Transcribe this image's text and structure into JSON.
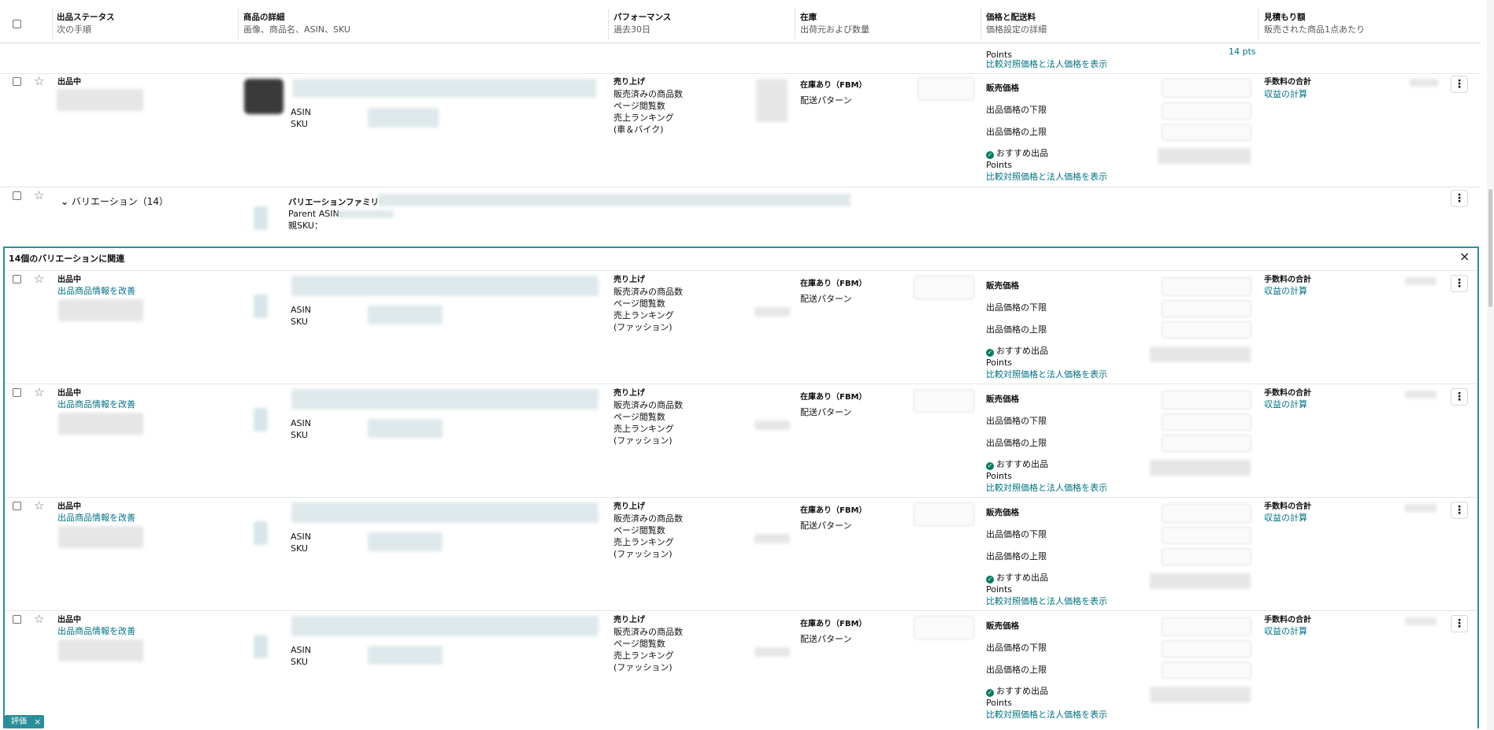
{
  "header": {
    "col_status": {
      "title": "出品ステータス",
      "sub": "次の手順"
    },
    "col_product": {
      "title": "商品の詳細",
      "sub": "画像、商品名、ASIN、SKU"
    },
    "col_perf": {
      "title": "パフォーマンス",
      "sub": "過去30日"
    },
    "col_stock": {
      "title": "在庫",
      "sub": "出荷元および数量"
    },
    "col_price": {
      "title": "価格と配送料",
      "sub": "価格設定の詳細"
    },
    "col_est": {
      "title": "見積もり額",
      "sub": "販売された商品1点あたり"
    }
  },
  "top_partial": {
    "points": "Points",
    "compare_link": "比較対照価格と法人価格を表示",
    "pts_value": "14 pts"
  },
  "row1": {
    "status": "出品中",
    "asin_label": "ASIN",
    "sku_label": "SKU",
    "perf": [
      "売り上げ",
      "販売済みの商品数",
      "ページ閲覧数",
      "売上ランキング",
      "(車＆バイク)"
    ],
    "stock_title": "在庫あり（FBM）",
    "shipping": "配送パターン",
    "price_label": "販売価格",
    "min_price": "出品価格の下限",
    "max_price": "出品価格の上限",
    "recommended": "おすすめ出品",
    "points": "Points",
    "compare_link": "比較対照価格と法人価格を表示",
    "fee_total": "手数料の合計",
    "profit_link": "収益の計算"
  },
  "variation_row": {
    "toggle": "バリエーション（14）",
    "family": "バリエーションファミリー",
    "parent_asin": "Parent ASIN:",
    "parent_sku": "親SKU："
  },
  "panel": {
    "title": "14個のバリエーションに関連",
    "close": "×"
  },
  "child_rows": [
    {
      "status": "出品中",
      "improve": "出品商品情報を改善",
      "asin_label": "ASIN",
      "sku_label": "SKU",
      "perf": [
        "売り上げ",
        "販売済みの商品数",
        "ページ閲覧数",
        "売上ランキング",
        "(ファッション)"
      ],
      "stock_title": "在庫あり（FBM）",
      "shipping": "配送パターン",
      "price_label": "販売価格",
      "min_price": "出品価格の下限",
      "max_price": "出品価格の上限",
      "recommended": "おすすめ出品",
      "points": "Points",
      "compare_link": "比較対照価格と法人価格を表示",
      "fee_total": "手数料の合計",
      "profit_link": "収益の計算"
    },
    {
      "status": "出品中",
      "improve": "出品商品情報を改善",
      "asin_label": "ASIN",
      "sku_label": "SKU",
      "perf": [
        "売り上げ",
        "販売済みの商品数",
        "ページ閲覧数",
        "売上ランキング",
        "(ファッション)"
      ],
      "stock_title": "在庫あり（FBM）",
      "shipping": "配送パターン",
      "price_label": "販売価格",
      "min_price": "出品価格の下限",
      "max_price": "出品価格の上限",
      "recommended": "おすすめ出品",
      "points": "Points",
      "compare_link": "比較対照価格と法人価格を表示",
      "fee_total": "手数料の合計",
      "profit_link": "収益の計算"
    },
    {
      "status": "出品中",
      "improve": "出品商品情報を改善",
      "asin_label": "ASIN",
      "sku_label": "SKU",
      "perf": [
        "売り上げ",
        "販売済みの商品数",
        "ページ閲覧数",
        "売上ランキング",
        "(ファッション)"
      ],
      "stock_title": "在庫あり（FBM）",
      "shipping": "配送パターン",
      "price_label": "販売価格",
      "min_price": "出品価格の下限",
      "max_price": "出品価格の上限",
      "recommended": "おすすめ出品",
      "points": "Points",
      "compare_link": "比較対照価格と法人価格を表示",
      "fee_total": "手数料の合計",
      "profit_link": "収益の計算"
    },
    {
      "status": "出品中",
      "improve": "出品商品情報を改善",
      "asin_label": "ASIN",
      "sku_label": "SKU",
      "perf": [
        "売り上げ",
        "販売済みの商品数",
        "ページ閲覧数",
        "売上ランキング",
        "(ファッション)"
      ],
      "stock_title": "在庫あり（FBM）",
      "shipping": "配送パターン",
      "price_label": "販売価格",
      "min_price": "出品価格の下限",
      "max_price": "出品価格の上限",
      "recommended": "おすすめ出品",
      "points": "Points",
      "compare_link": "比較対照価格と法人価格を表示",
      "fee_total": "手数料の合計",
      "profit_link": "収益の計算"
    }
  ],
  "bottom_tag": {
    "label": "評価",
    "close": "×"
  },
  "colors": {
    "link": "#007185",
    "panel_border": "#2a8f9a",
    "check": "#067d62"
  }
}
